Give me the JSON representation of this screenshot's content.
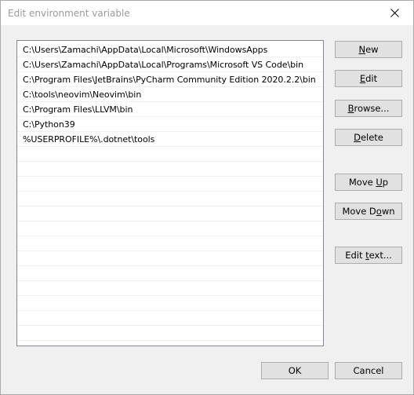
{
  "window": {
    "title": "Edit environment variable"
  },
  "paths": [
    "C:\\Users\\Zamachi\\AppData\\Local\\Microsoft\\WindowsApps",
    "C:\\Users\\Zamachi\\AppData\\Local\\Programs\\Microsoft VS Code\\bin",
    "C:\\Program Files\\JetBrains\\PyCharm Community Edition 2020.2.2\\bin",
    "C:\\tools\\neovim\\Neovim\\bin",
    "C:\\Program Files\\LLVM\\bin",
    "C:\\Python39",
    "%USERPROFILE%\\.dotnet\\tools"
  ],
  "buttons": {
    "new": {
      "pre": "",
      "key": "N",
      "post": "ew"
    },
    "edit": {
      "pre": "",
      "key": "E",
      "post": "dit"
    },
    "browse": {
      "pre": "",
      "key": "B",
      "post": "rowse..."
    },
    "delete": {
      "pre": "",
      "key": "D",
      "post": "elete"
    },
    "move_up": {
      "pre": "Move ",
      "key": "U",
      "post": "p"
    },
    "move_down": {
      "pre": "Move D",
      "key": "o",
      "post": "wn"
    },
    "edit_text": {
      "pre": "Edit ",
      "key": "t",
      "post": "ext..."
    },
    "ok": {
      "pre": "OK",
      "key": "",
      "post": ""
    },
    "cancel": {
      "pre": "Cancel",
      "key": "",
      "post": ""
    }
  },
  "colors": {
    "button_face": "#e1e1e1",
    "button_border": "#adadad",
    "list_border": "#828790",
    "dialog_bg": "#f0f0f0",
    "title_text": "#999999"
  }
}
